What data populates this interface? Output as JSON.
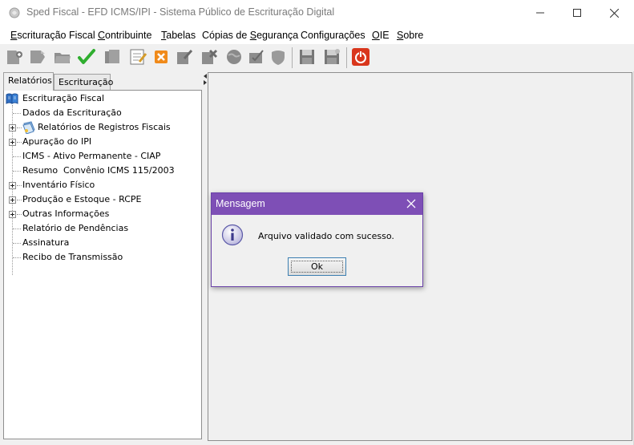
{
  "window": {
    "title": "Sped Fiscal - EFD ICMS/IPI - Sistema Público de Escrituração Digital"
  },
  "menu": {
    "items": [
      {
        "mnemonic": "E",
        "rest": "scrituração Fiscal"
      },
      {
        "mnemonic": "C",
        "rest": "ontribuinte"
      },
      {
        "mnemonic": "T",
        "rest": "abelas"
      },
      {
        "pre": "Cópias de ",
        "mnemonic": "S",
        "rest": "egurança"
      },
      {
        "pre": "Confi",
        "mnemonic": "g",
        "rest": "urações"
      },
      {
        "mnemonic": "O",
        "rest": "IE"
      },
      {
        "mnemonic": "S",
        "rest": "obre"
      }
    ]
  },
  "tabs": [
    {
      "label": "Relatórios",
      "active": true
    },
    {
      "label": "Escrituração",
      "active": false
    }
  ],
  "tree": {
    "root": "Escrituração Fiscal",
    "items": [
      {
        "label": "Dados da Escrituração",
        "expandable": false
      },
      {
        "label": "Relatórios de Registros Fiscais",
        "expandable": true,
        "icon": "report-book-icon"
      },
      {
        "label": "Apuração do IPI",
        "expandable": true
      },
      {
        "label": "ICMS - Ativo Permanente - CIAP",
        "expandable": false
      },
      {
        "label": "Resumo  Convênio ICMS 115/2003",
        "expandable": false
      },
      {
        "label": "Inventário Físico",
        "expandable": true
      },
      {
        "label": "Produção e Estoque - RCPE",
        "expandable": true
      },
      {
        "label": "Outras Informações",
        "expandable": true
      },
      {
        "label": "Relatório de Pendências",
        "expandable": false
      },
      {
        "label": "Assinatura",
        "expandable": false
      },
      {
        "label": "Recibo de Transmissão",
        "expandable": false
      }
    ]
  },
  "dialog": {
    "title": "Mensagem",
    "message": "Arquivo validado com sucesso.",
    "ok_label": "Ok"
  },
  "colors": {
    "dialog_title_bg": "#7e4fb6",
    "dialog_border": "#6a42a8",
    "check_green": "#2fae2f",
    "exit_red": "#d9361c"
  },
  "icons": {
    "toolbar": [
      "new-file-icon",
      "import-icon",
      "open-folder-icon",
      "validate-check-icon",
      "copy-icon",
      "edit-note-icon",
      "close-x-icon",
      "sign-icon",
      "transmit-icon",
      "globe-icon",
      "receipt-icon",
      "shield-icon",
      "save-icon",
      "save-as-icon",
      "exit-icon"
    ]
  }
}
